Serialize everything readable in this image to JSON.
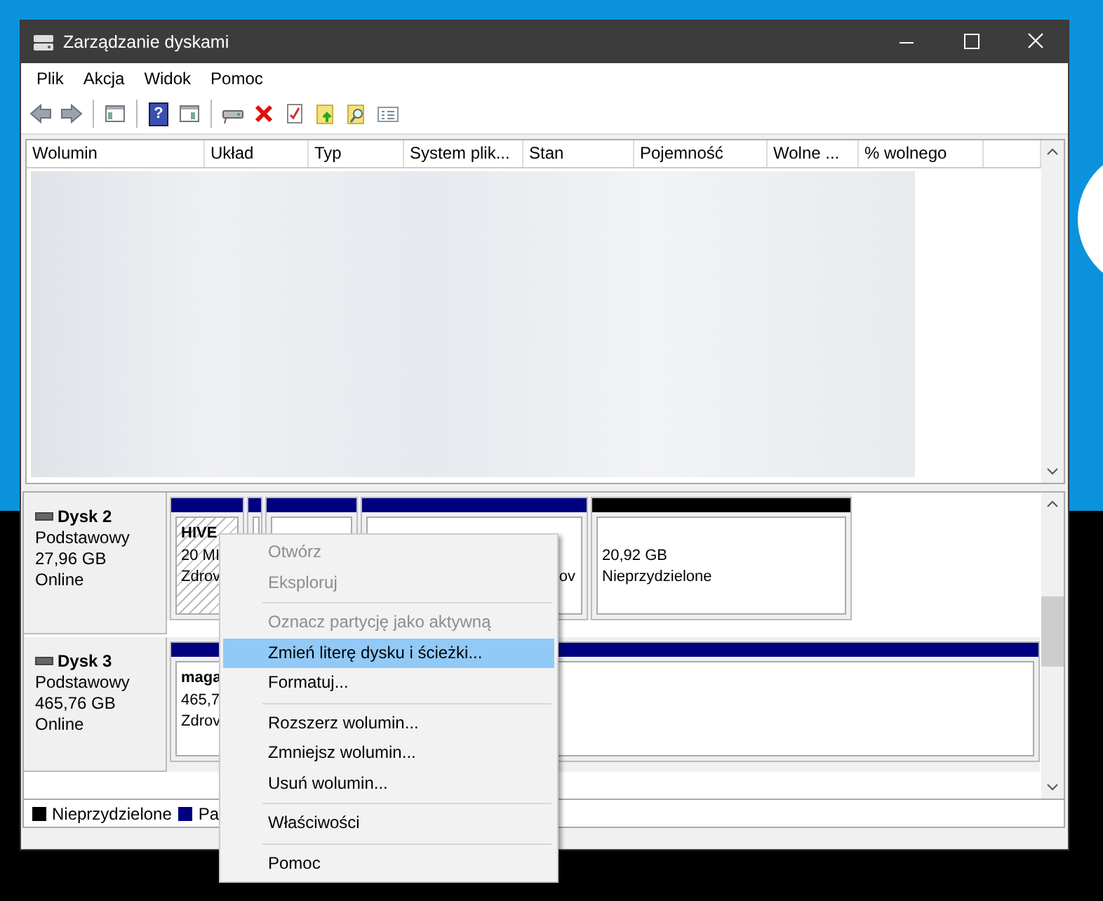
{
  "window": {
    "title": "Zarządzanie dyskami"
  },
  "menu": [
    "Plik",
    "Akcja",
    "Widok",
    "Pomoc"
  ],
  "toolbar": [
    {
      "kind": "back"
    },
    {
      "kind": "forward"
    },
    {
      "kind": "separator"
    },
    {
      "kind": "tree"
    },
    {
      "kind": "separator"
    },
    {
      "kind": "help",
      "glyph": "?"
    },
    {
      "kind": "panel"
    },
    {
      "kind": "separator"
    },
    {
      "kind": "drive"
    },
    {
      "kind": "delete"
    },
    {
      "kind": "check"
    },
    {
      "kind": "folder-up"
    },
    {
      "kind": "folder-search"
    },
    {
      "kind": "list"
    }
  ],
  "volume_list": {
    "columns": [
      "Wolumin",
      "Układ",
      "Typ",
      "System plik...",
      "Stan",
      "Pojemność",
      "Wolne ...",
      "% wolnego"
    ]
  },
  "disks": [
    {
      "name": "Dysk 2",
      "type": "Podstawowy",
      "size": "27,96 GB",
      "status": "Online",
      "partitions": [
        {
          "color": "#000080",
          "hatched": true,
          "name": "HIVE",
          "details": [
            "20 MI",
            "Zdrov"
          ]
        },
        {
          "color": "#000080",
          "hatched": false
        },
        {
          "color": "#000080",
          "hatched": false
        },
        {
          "color": "#000080",
          "hatched": false,
          "covered": true,
          "details": [
            "ov"
          ]
        },
        {
          "color": "#000000",
          "hatched": false,
          "details": [
            "20,92 GB",
            "Nieprzydzielone"
          ]
        }
      ]
    },
    {
      "name": "Dysk 3",
      "type": "Podstawowy",
      "size": "465,76 GB",
      "status": "Online",
      "partitions": [
        {
          "color": "#000080",
          "hatched": false,
          "name": "maga",
          "details": [
            "465,7",
            "Zdrov"
          ]
        }
      ]
    }
  ],
  "legend": [
    {
      "label": "Nieprzydzielone",
      "color": "#000000"
    },
    {
      "label": "Pa",
      "color": "#000080"
    }
  ],
  "context_menu": [
    {
      "kind": "item",
      "label": "Otwórz",
      "disabled": true,
      "selected": false
    },
    {
      "kind": "item",
      "label": "Eksploruj",
      "disabled": true,
      "selected": false
    },
    {
      "kind": "separator"
    },
    {
      "kind": "item",
      "label": "Oznacz partycję jako aktywną",
      "disabled": true,
      "selected": false
    },
    {
      "kind": "item",
      "label": "Zmień literę dysku i ścieżki...",
      "disabled": false,
      "selected": true
    },
    {
      "kind": "item",
      "label": "Formatuj...",
      "disabled": false,
      "selected": false
    },
    {
      "kind": "separator"
    },
    {
      "kind": "item",
      "label": "Rozszerz wolumin...",
      "disabled": false,
      "selected": false
    },
    {
      "kind": "item",
      "label": "Zmniejsz wolumin...",
      "disabled": false,
      "selected": false
    },
    {
      "kind": "item",
      "label": "Usuń wolumin...",
      "disabled": false,
      "selected": false
    },
    {
      "kind": "separator"
    },
    {
      "kind": "item",
      "label": "Właściwości",
      "disabled": false,
      "selected": false
    },
    {
      "kind": "separator"
    },
    {
      "kind": "item",
      "label": "Pomoc",
      "disabled": false,
      "selected": false
    }
  ]
}
